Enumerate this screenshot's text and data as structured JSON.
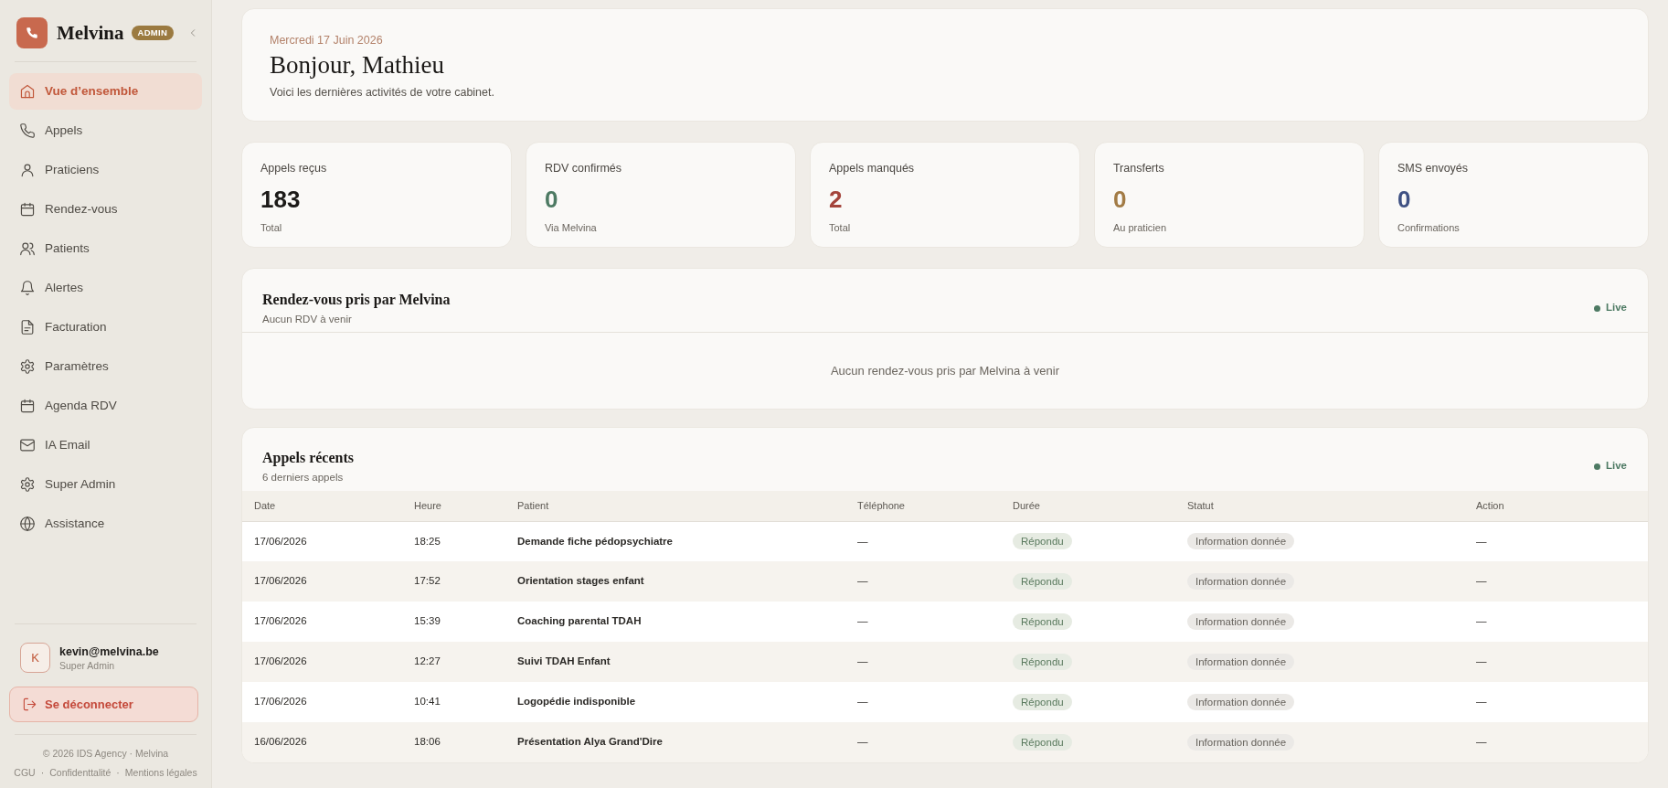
{
  "sidebar": {
    "brand": "Melvina",
    "badge": "ADMIN",
    "items": [
      {
        "label": "Vue d’ensemble",
        "selected": true
      },
      {
        "label": "Appels",
        "selected": false
      },
      {
        "label": "Praticiens",
        "selected": false
      },
      {
        "label": "Rendez-vous",
        "selected": false
      },
      {
        "label": "Patients",
        "selected": false
      },
      {
        "label": "Alertes",
        "selected": false
      },
      {
        "label": "Facturation",
        "selected": false
      },
      {
        "label": "Paramètres",
        "selected": false
      },
      {
        "label": "Agenda RDV",
        "selected": false
      },
      {
        "label": "IA Email",
        "selected": false
      },
      {
        "label": "Super Admin",
        "selected": false
      },
      {
        "label": "Assistance",
        "selected": false
      }
    ],
    "user": {
      "initial": "K",
      "email": "kevin@melvina.be",
      "role": "Super Admin"
    },
    "logout": "Se déconnecter",
    "footer": {
      "copyright": "© 2026 IDS Agency · Melvina",
      "links": [
        "CGU",
        "Confidenttalité",
        "Mentions légales"
      ],
      "separator": "·"
    }
  },
  "header": {
    "date": "Mercredi 17 Juin 2026",
    "greeting": "Bonjour, Mathieu",
    "subtitle": "Voici les dernières activités de votre cabinet."
  },
  "stats": [
    {
      "label": "Appels reçus",
      "value": "183",
      "caption": "Total",
      "color": "#1c1a18"
    },
    {
      "label": "RDV confirmés",
      "value": "0",
      "caption": "Via Melvina",
      "color": "#4d7a63"
    },
    {
      "label": "Appels manqués",
      "value": "2",
      "caption": "Total",
      "color": "#a4443b"
    },
    {
      "label": "Transferts",
      "value": "0",
      "caption": "Au praticien",
      "color": "#a27b45"
    },
    {
      "label": "SMS envoyés",
      "value": "0",
      "caption": "Confirmations",
      "color": "#3f5183"
    }
  ],
  "appointments": {
    "title": "Rendez-vous pris par Melvina",
    "subtitle": "Aucun RDV à venir",
    "live": "Live",
    "empty": "Aucun rendez-vous pris par Melvina à venir"
  },
  "recent_calls": {
    "title": "Appels récents",
    "subtitle": "6 derniers appels",
    "live": "Live",
    "table": {
      "columns": [
        "Date",
        "Heure",
        "Patient",
        "Téléphone",
        "Durée",
        "Statut",
        "Action"
      ],
      "rows": [
        {
          "date": "17/06/2026",
          "time": "18:25",
          "patient": "Demande fiche pédopsychiatre",
          "phone": "—",
          "duration": "Répondu",
          "status": "Information donnée",
          "action": "—"
        },
        {
          "date": "17/06/2026",
          "time": "17:52",
          "patient": "Orientation stages enfant",
          "phone": "—",
          "duration": "Répondu",
          "status": "Information donnée",
          "action": "—"
        },
        {
          "date": "17/06/2026",
          "time": "15:39",
          "patient": "Coaching parental TDAH",
          "phone": "—",
          "duration": "Répondu",
          "status": "Information donnée",
          "action": "—"
        },
        {
          "date": "17/06/2026",
          "time": "12:27",
          "patient": "Suivi TDAH Enfant",
          "phone": "—",
          "duration": "Répondu",
          "status": "Information donnée",
          "action": "—"
        },
        {
          "date": "17/06/2026",
          "time": "10:41",
          "patient": "Logopédie indisponible",
          "phone": "—",
          "duration": "Répondu",
          "status": "Information donnée",
          "action": "—"
        },
        {
          "date": "16/06/2026",
          "time": "18:06",
          "patient": "Présentation Alya Grand'Dire",
          "phone": "—",
          "duration": "Répondu",
          "status": "Information donnée",
          "action": "—"
        }
      ]
    }
  }
}
